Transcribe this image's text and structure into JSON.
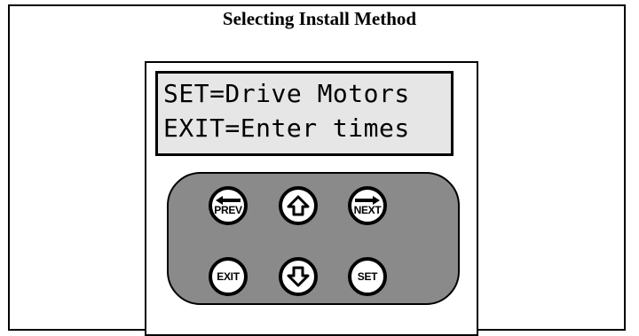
{
  "title": "Selecting Install Method",
  "lcd": {
    "line1": "SET=Drive Motors",
    "line2": "EXIT=Enter times"
  },
  "keypad": {
    "prev_label": "PREV",
    "next_label": "NEXT",
    "exit_label": "EXIT",
    "set_label": "SET",
    "up_icon": "up-arrow-icon",
    "down_icon": "down-arrow-icon",
    "left_icon": "left-arrow-icon",
    "right_icon": "right-arrow-icon"
  },
  "colors": {
    "keypad_bg": "#8a8a8a",
    "lcd_bg": "#e6e6e6"
  }
}
